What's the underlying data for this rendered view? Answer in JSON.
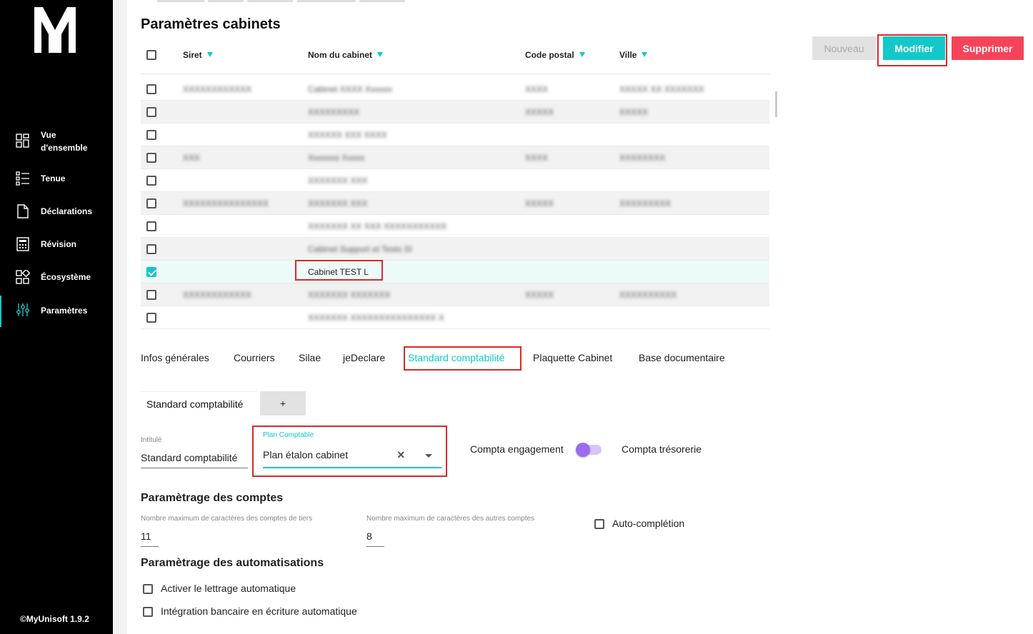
{
  "app": {
    "version": "©MyUnisoft 1.9.2",
    "logo_letter": "M"
  },
  "sidebar": {
    "items": [
      {
        "label": "Vue d'ensemble",
        "icon": "dashboard-icon"
      },
      {
        "label": "Tenue",
        "icon": "list-icon"
      },
      {
        "label": "Déclarations",
        "icon": "document-icon"
      },
      {
        "label": "Révision",
        "icon": "calculator-icon"
      },
      {
        "label": "Écosystème",
        "icon": "ecosystem-icon"
      },
      {
        "label": "Paramètres",
        "icon": "sliders-icon",
        "active": true
      }
    ]
  },
  "page": {
    "title": "Paramètres cabinets"
  },
  "actions": {
    "new_label": "Nouveau",
    "edit_label": "Modifier",
    "delete_label": "Supprimer"
  },
  "table": {
    "columns": [
      "Siret",
      "Nom du cabinet",
      "Code postal",
      "Ville"
    ],
    "rows": [
      {
        "siret": "XXXXXXXXXXXX",
        "name": "Cabinet XXXX Xxxxxx",
        "cp": "XXXX",
        "city": "XXXXX XX XXXXXXX",
        "checked": false,
        "blurred": true
      },
      {
        "siret": "",
        "name": "XXXXXXXXX",
        "cp": "XXXXX",
        "city": "XXXXX",
        "checked": false,
        "blurred": true
      },
      {
        "siret": "",
        "name": "XXXXXX XXX XXXX",
        "cp": "",
        "city": "",
        "checked": false,
        "blurred": true
      },
      {
        "siret": "XXX",
        "name": "Xxxxxxx Xxxxx",
        "cp": "XXXX",
        "city": "XXXXXXXX",
        "checked": false,
        "blurred": true
      },
      {
        "siret": "",
        "name": "XXXXXXX XXX",
        "cp": "",
        "city": "",
        "checked": false,
        "blurred": true
      },
      {
        "siret": "XXXXXXXXXXXXXXX",
        "name": "XXXXXXX XXX",
        "cp": "XXXXX",
        "city": "XXXXXXXXX",
        "checked": false,
        "blurred": true
      },
      {
        "siret": "",
        "name": "XXXXXXX XX XXX XXXXXXXXXXX",
        "cp": "",
        "city": "",
        "checked": false,
        "blurred": true
      },
      {
        "siret": "",
        "name": "Cabinet Support et Tests SI",
        "cp": "",
        "city": "",
        "checked": false,
        "blurred": true
      },
      {
        "siret": "",
        "name": "Cabinet TEST L",
        "cp": "",
        "city": "",
        "checked": true,
        "blurred": false
      },
      {
        "siret": "XXXXXXXXXXXX",
        "name": "XXXXXXX XXXXXXX",
        "cp": "XXXXX",
        "city": "XXXXXXXXXX",
        "checked": false,
        "blurred": true
      },
      {
        "siret": "",
        "name": "XXXXXXX XXXXXXXXXXXXXXX X",
        "cp": "",
        "city": "",
        "checked": false,
        "blurred": true
      }
    ]
  },
  "tabs": [
    "Infos générales",
    "Courriers",
    "Silae",
    "jeDeclare",
    "Standard comptabilité",
    "Plaquette Cabinet",
    "Base documentaire"
  ],
  "standard": {
    "subtab_label": "Standard comptabilité",
    "add_label": "+",
    "intitule_label": "Intitulé",
    "intitule_value": "Standard comptabilité",
    "plan_label": "Plan Comptable",
    "plan_value": "Plan étalon cabinet",
    "compta_engagement": "Compta engagement",
    "compta_tresorerie": "Compta trésorerie",
    "toggle_state": "engagement"
  },
  "accounts": {
    "title": "Paramètrage des comptes",
    "tiers_label": "Nombre maximum de caractères des comptes de tiers",
    "tiers_value": "11",
    "autres_label": "Nombre maximum de caractères des autres comptes",
    "autres_value": "8",
    "autocompletion_label": "Auto-complétion"
  },
  "automations": {
    "title": "Paramètrage des automatisations",
    "lettrage_label": "Activer le lettrage automatique",
    "bancaire_label": "Intégration bancaire en écriture automatique"
  },
  "colors": {
    "accent": "#13c8c8",
    "danger": "#f5445a",
    "disabled": "#e0e0e0",
    "highlight": "#d72a2a",
    "toggle": "#9c6cf0"
  }
}
